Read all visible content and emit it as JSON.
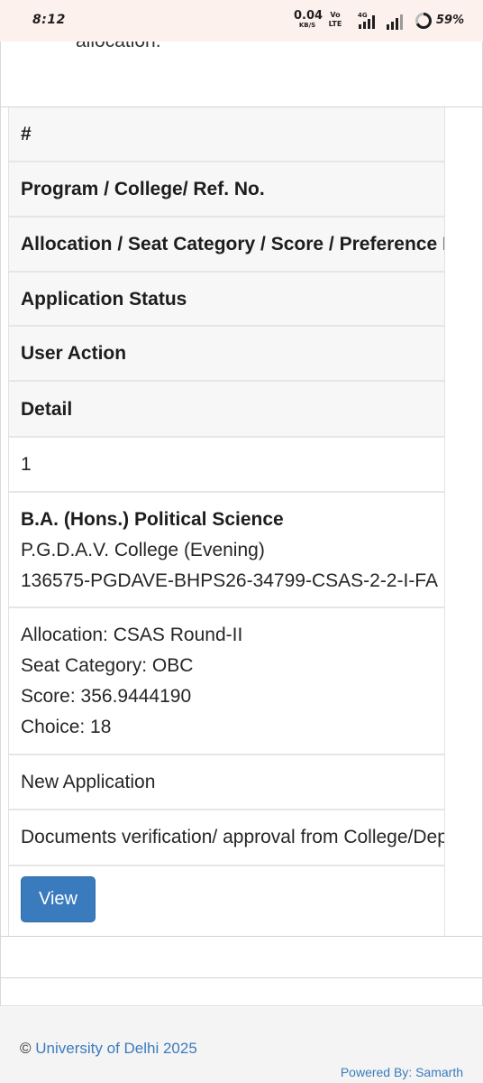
{
  "status_bar": {
    "time": "8:12",
    "net_speed": "0.04",
    "net_unit": "KB/S",
    "volte_top": "Vo",
    "volte_bottom": "LTE",
    "network_type": "4G",
    "battery_percent": "59%"
  },
  "page": {
    "cut_off_text": "allocation."
  },
  "table": {
    "headers": [
      "#",
      "Program / College/ Ref. No.",
      "Allocation / Seat Category / Score / Preference No.",
      "Application Status",
      "User Action",
      "Detail"
    ],
    "row": {
      "index": "1",
      "program": "B.A. (Hons.) Political Science",
      "college": "P.G.D.A.V. College (Evening)",
      "ref_no": "136575-PGDAVE-BHPS26-34799-CSAS-2-2-I-FA",
      "allocation": "Allocation: CSAS Round-II",
      "seat_category": "Seat Category: OBC",
      "score": "Score: 356.9444190",
      "choice": "Choice: 18",
      "application_status": "New Application",
      "user_action": "Documents verification/ approval from College/Department",
      "detail_button": "View"
    }
  },
  "footer": {
    "copyright_symbol": "©",
    "copyright_link": "University of Delhi 2025",
    "powered_by": "Powered By: Samarth"
  },
  "colors": {
    "accent": "#3a7bbd",
    "status_bar_bg": "#fdf1ee",
    "header_row_bg": "#f7f7f7",
    "footer_bg": "#f4f4f4"
  }
}
